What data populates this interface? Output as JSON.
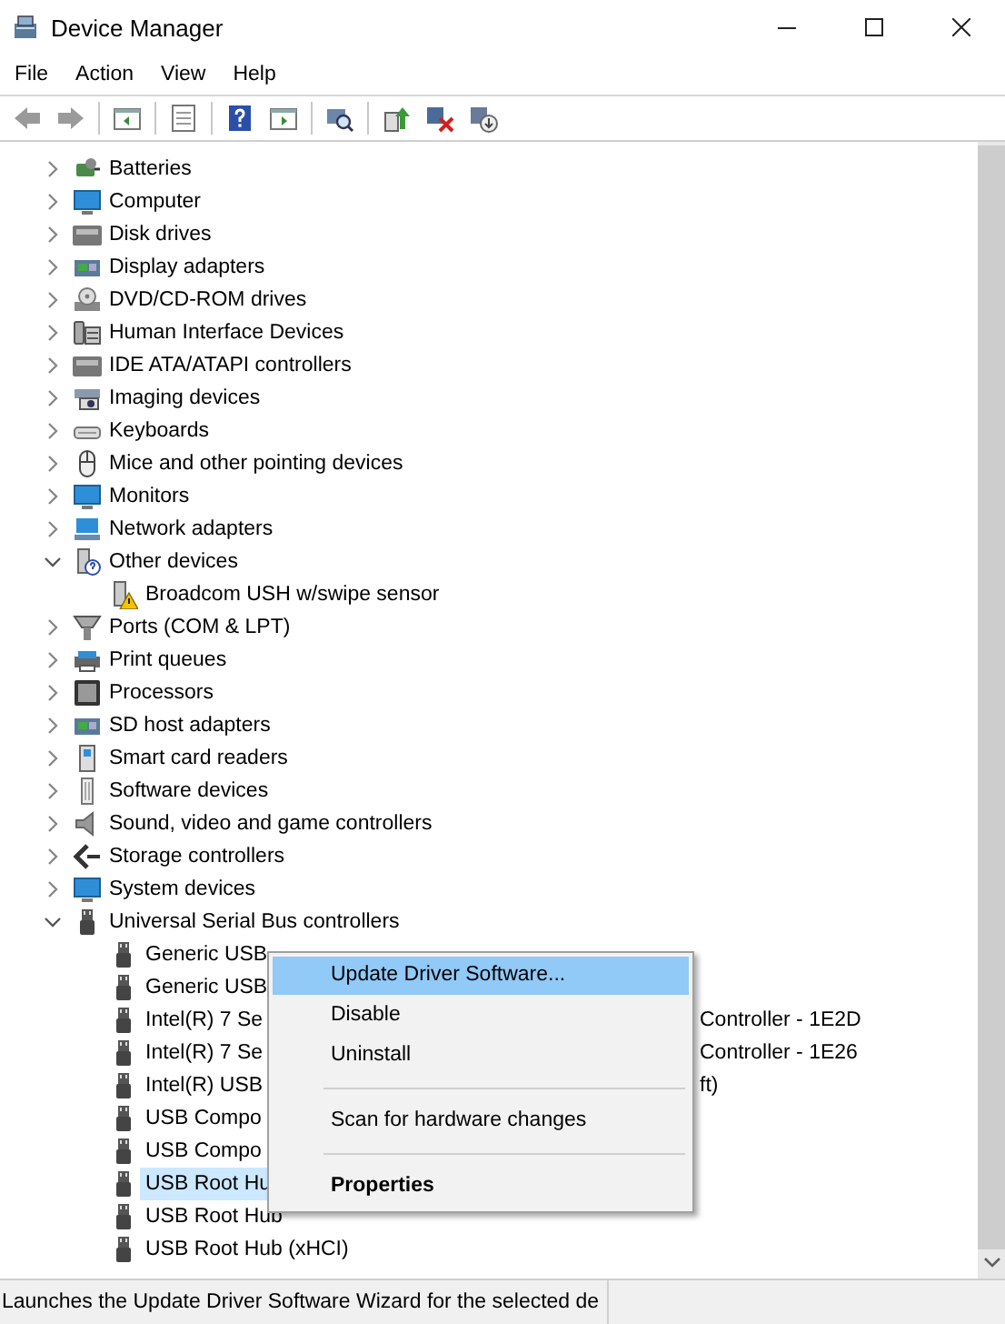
{
  "window": {
    "title": "Device Manager"
  },
  "menu_bar": [
    "File",
    "Action",
    "View",
    "Help"
  ],
  "toolbar": [
    {
      "kind": "back"
    },
    {
      "kind": "forward"
    },
    {
      "kind": "sep"
    },
    {
      "kind": "tree-pane"
    },
    {
      "kind": "sep"
    },
    {
      "kind": "properties"
    },
    {
      "kind": "sep"
    },
    {
      "kind": "help"
    },
    {
      "kind": "action-pane"
    },
    {
      "kind": "sep"
    },
    {
      "kind": "scan"
    },
    {
      "kind": "sep"
    },
    {
      "kind": "update"
    },
    {
      "kind": "uninstall"
    },
    {
      "kind": "install"
    }
  ],
  "tree": [
    {
      "label": "Batteries",
      "kind": "battery",
      "expanded": false,
      "selected": false
    },
    {
      "label": "Computer",
      "kind": "computer",
      "expanded": false,
      "selected": false
    },
    {
      "label": "Disk drives",
      "kind": "disk",
      "expanded": false,
      "selected": false
    },
    {
      "label": "Display adapters",
      "kind": "card",
      "expanded": false,
      "selected": false
    },
    {
      "label": "DVD/CD-ROM drives",
      "kind": "dvd",
      "expanded": false,
      "selected": false
    },
    {
      "label": "Human Interface Devices",
      "kind": "hid",
      "expanded": false,
      "selected": false
    },
    {
      "label": "IDE ATA/ATAPI controllers",
      "kind": "disk",
      "expanded": false,
      "selected": false
    },
    {
      "label": "Imaging devices",
      "kind": "camera",
      "expanded": false,
      "selected": false
    },
    {
      "label": "Keyboards",
      "kind": "keyboard",
      "expanded": false,
      "selected": false
    },
    {
      "label": "Mice and other pointing devices",
      "kind": "mouse",
      "expanded": false,
      "selected": false
    },
    {
      "label": "Monitors",
      "kind": "computer",
      "expanded": false,
      "selected": false
    },
    {
      "label": "Network adapters",
      "kind": "network",
      "expanded": false,
      "selected": false
    },
    {
      "label": "Other devices",
      "kind": "unknown",
      "expanded": true,
      "selected": false,
      "children": [
        {
          "label": "Broadcom USH w/swipe sensor",
          "kind": "warning",
          "selected": false
        }
      ]
    },
    {
      "label": "Ports (COM & LPT)",
      "kind": "port",
      "expanded": false,
      "selected": false
    },
    {
      "label": "Print queues",
      "kind": "printer",
      "expanded": false,
      "selected": false
    },
    {
      "label": "Processors",
      "kind": "chip",
      "expanded": false,
      "selected": false
    },
    {
      "label": "SD host adapters",
      "kind": "card",
      "expanded": false,
      "selected": false
    },
    {
      "label": "Smart card readers",
      "kind": "reader",
      "expanded": false,
      "selected": false
    },
    {
      "label": "Software devices",
      "kind": "software",
      "expanded": false,
      "selected": false
    },
    {
      "label": "Sound, video and game controllers",
      "kind": "speaker",
      "expanded": false,
      "selected": false
    },
    {
      "label": "Storage controllers",
      "kind": "storage",
      "expanded": false,
      "selected": false
    },
    {
      "label": "System devices",
      "kind": "computer",
      "expanded": false,
      "selected": false
    },
    {
      "label": "Universal Serial Bus controllers",
      "kind": "usb",
      "expanded": true,
      "selected": false,
      "children": [
        {
          "label": "Generic USB",
          "kind": "usb",
          "selected": false
        },
        {
          "label": "Generic USB",
          "kind": "usb",
          "selected": false
        },
        {
          "label": "Intel(R) 7 Se",
          "tail": "Controller - 1E2D",
          "kind": "usb",
          "selected": false
        },
        {
          "label": "Intel(R) 7 Se",
          "tail": "Controller - 1E26",
          "kind": "usb",
          "selected": false
        },
        {
          "label": "Intel(R) USB",
          "tail": "ft)",
          "kind": "usb",
          "selected": false
        },
        {
          "label": "USB Compo",
          "kind": "usb",
          "selected": false
        },
        {
          "label": "USB Compo",
          "kind": "usb",
          "selected": false
        },
        {
          "label": "USB Root Hu",
          "kind": "usb",
          "selected": true
        },
        {
          "label": "USB Root Hub",
          "kind": "usb",
          "selected": false
        },
        {
          "label": "USB Root Hub (xHCI)",
          "kind": "usb",
          "selected": false
        }
      ]
    }
  ],
  "context_menu": {
    "items": [
      {
        "kind": "item",
        "label": "Update Driver Software...",
        "highlighted": true,
        "default": false
      },
      {
        "kind": "item",
        "label": "Disable",
        "highlighted": false,
        "default": false
      },
      {
        "kind": "item",
        "label": "Uninstall",
        "highlighted": false,
        "default": false
      },
      {
        "kind": "separator"
      },
      {
        "kind": "item",
        "label": "Scan for hardware changes",
        "highlighted": false,
        "default": false
      },
      {
        "kind": "separator"
      },
      {
        "kind": "item",
        "label": "Properties",
        "highlighted": false,
        "default": true
      }
    ]
  },
  "status_bar": {
    "text": "Launches the Update Driver Software Wizard for the selected de"
  }
}
